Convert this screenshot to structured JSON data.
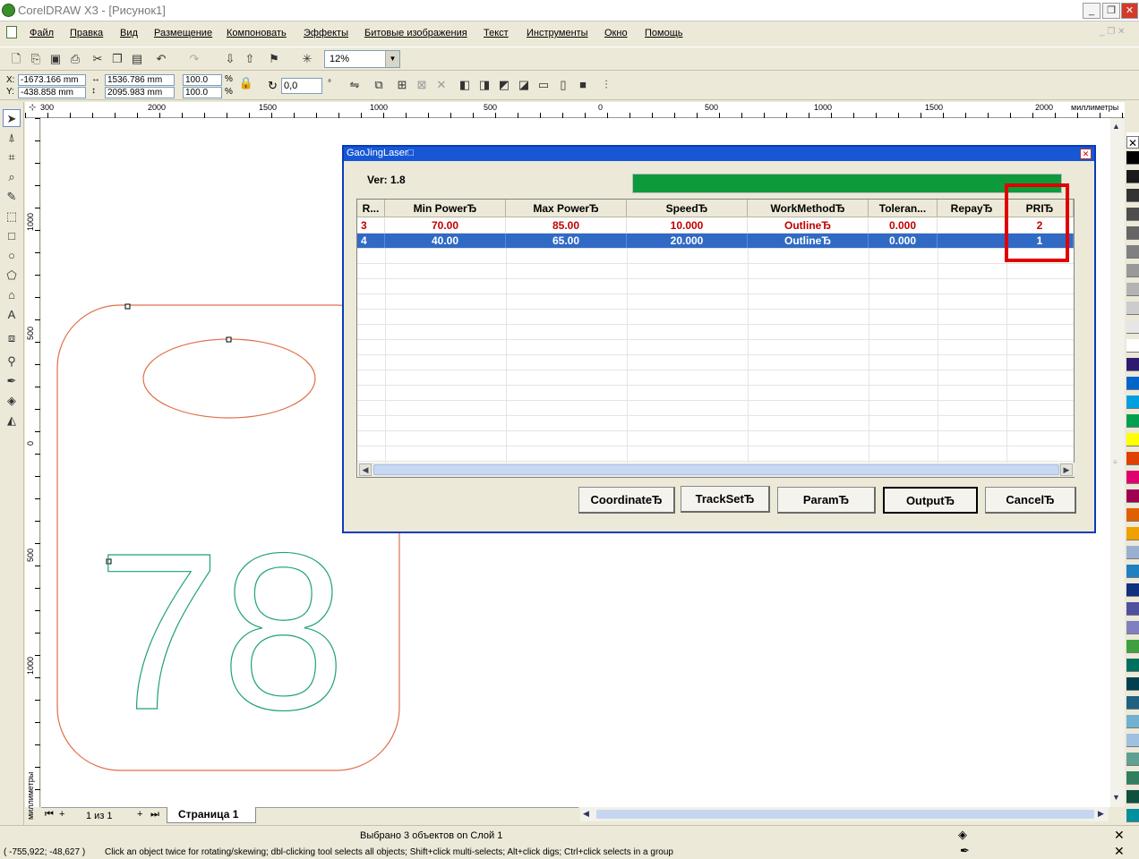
{
  "window": {
    "title": "CorelDRAW X3 - [Рисунок1]",
    "controls": [
      "_",
      "❐",
      "✕"
    ]
  },
  "menu": [
    "Файл",
    "Правка",
    "Вид",
    "Размещение",
    "Компоновать",
    "Эффекты",
    "Битовые изображения",
    "Текст",
    "Инструменты",
    "Окно",
    "Помощь"
  ],
  "toolbar": {
    "zoom": "12%"
  },
  "propbar": {
    "x_label": "X:",
    "y_label": "Y:",
    "x": "-1673.166 mm",
    "y": "-438.858 mm",
    "w": "1536.786 mm",
    "h": "2095.983 mm",
    "scale_x": "100.0",
    "scale_y": "100.0",
    "pct": "%",
    "angle": "0,0",
    "deg": "°"
  },
  "ruler": {
    "h_ticks": [
      "300",
      "2000",
      "1500",
      "1000",
      "500",
      "0",
      "500",
      "1000",
      "1500",
      "2000"
    ],
    "unit": "миллиметры",
    "v_ticks": [
      "1000",
      "500",
      "0",
      "500",
      "1000"
    ],
    "v_unit": "миллиметры"
  },
  "canvas": {
    "number_text": "78"
  },
  "pagebar": {
    "page_count": "1 из 1",
    "page_tab": "Страница 1"
  },
  "status": {
    "selection": "Выбрано 3 объектов on Слой 1",
    "coords": "( -755,922; -48,627 )",
    "hint": "Click an object twice for rotating/skewing; dbl-clicking tool selects all objects; Shift+click multi-selects; Alt+click digs; Ctrl+click selects in a group"
  },
  "dialog": {
    "title": "GaoJingLaser□",
    "version": "Ver: 1.8",
    "progress": 1.0,
    "columns": [
      "R...",
      "Min PowerЂ",
      "Max PowerЂ",
      "SpeedЂ",
      "WorkMethodЂ",
      "Toleran...",
      "RepayЂ",
      "PRIЂ"
    ],
    "rows": [
      [
        "3",
        "70.00",
        "85.00",
        "10.000",
        "OutlineЂ",
        "0.000",
        "",
        "2"
      ],
      [
        "4",
        "40.00",
        "65.00",
        "20.000",
        "OutlineЂ",
        "0.000",
        "",
        "1"
      ]
    ],
    "buttons": [
      "CoordinateЂ",
      "TrackSetЂ",
      "ParamЂ",
      "OutputЂ",
      "CancelЂ"
    ]
  },
  "colors": {
    "dialog_title": "#1757d6",
    "progress": "#0c9a3c",
    "highlight": "#e00000",
    "shape_outline": "#e0704a",
    "text_outline": "#1ea07a"
  },
  "palette": [
    "#ffffff",
    "#000000",
    "#1a1a1a",
    "#333333",
    "#4d4d4d",
    "#666666",
    "#808080",
    "#999999",
    "#b3b3b3",
    "#cccccc",
    "#e6e6e6",
    "#ffffff",
    "#2e1a6e",
    "#0066cc",
    "#00a0e0",
    "#00a050",
    "#ffff00",
    "#e04000",
    "#e0006e",
    "#a00050",
    "#e06000",
    "#f0a000",
    "#9ab0d0",
    "#2080c0",
    "#103080",
    "#5050a0",
    "#8080c0",
    "#40a040",
    "#007060",
    "#004050",
    "#206080",
    "#70b0d0",
    "#a0c0e0",
    "#60a090",
    "#308060",
    "#105040",
    "#0090a0"
  ]
}
